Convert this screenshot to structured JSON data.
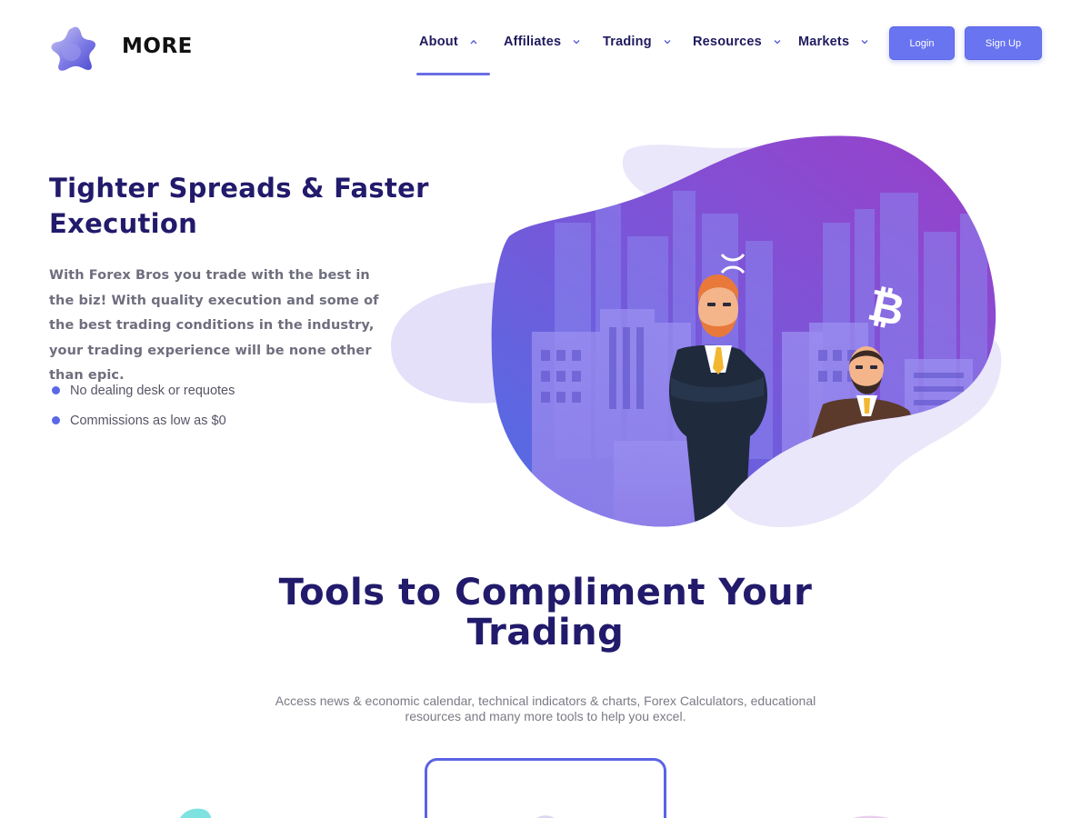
{
  "header": {
    "brand": "MORE",
    "nav": [
      {
        "label": "About",
        "active": true
      },
      {
        "label": "Affiliates",
        "active": false
      },
      {
        "label": "Trading",
        "active": false
      },
      {
        "label": "Resources",
        "active": false
      },
      {
        "label": "Markets",
        "active": false
      }
    ],
    "login_label": "Login",
    "signup_label": "Sign Up"
  },
  "hero": {
    "title": "Tighter Spreads & Faster Execution",
    "body": "With Forex Bros you trade with the best in the biz! With quality execution and some of the best trading conditions in the industry, your trading experience will be none other than epic.",
    "bullets": [
      "No dealing desk or requotes",
      "Commissions as low as $0"
    ]
  },
  "tools": {
    "title": "Tools to Compliment Your Trading",
    "description": "Access news & economic calendar, technical indicators & charts, Forex Calculators, educational resources and many more tools to help you excel."
  },
  "colors": {
    "accent": "#6975f0",
    "heading": "#221a6b",
    "text": "#6f6e7e"
  },
  "icons": {
    "logo": "star-blob-logo",
    "chevron": "chevron-down-icon",
    "chevron_active": "chevron-up-icon",
    "bullet": "bullet-dot-icon"
  }
}
